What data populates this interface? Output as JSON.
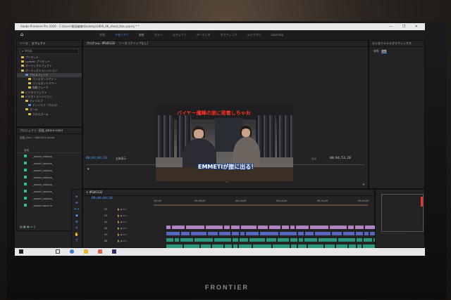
{
  "titlebar": {
    "title": "Adobe Premiere Pro 2020 - C:\\Users\\動画編集\\Desktop\\1809_06_shoot_bizu.prproj * *"
  },
  "workspaces": {
    "tabs": [
      "学習",
      "アセンブリ",
      "編集",
      "カラー",
      "エフェクト",
      "オーディオ",
      "グラフィック",
      "ライブラリ",
      "Learning"
    ],
    "active": "アセンブリ"
  },
  "left_panel": {
    "tabs": [
      "ソース",
      "エフェクト"
    ],
    "search": "クロス",
    "tree": [
      "プリセット",
      "Lumetri プリセット",
      "オーディオエフェクト",
      "オーディオトランジション",
      "クロスフェード",
      "コンスタントゲイン",
      "コンスタントパワー",
      "指数フェード",
      "ビデオエフェクト",
      "ビデオトランジション",
      "ディゾルブ",
      "ディゾルブ（クロス）",
      "ズーム",
      "クロスズーム"
    ]
  },
  "project_panel": {
    "title": "プロジェクト: 容疑_kotare.ssekt",
    "file": "容疑_kota....0B01022.prproj",
    "column": "名前",
    "items": [
      "_sound_various_",
      "_sound_various_",
      "_sound_various_",
      "_sound_various_",
      "_sound_various_",
      "_sound_various_",
      "_sound_various_",
      "_sound voice m"
    ]
  },
  "program_monitor": {
    "tab": "プログラム: IPS45132",
    "tab2": "ソース: (クリップなし)",
    "timecode": "00;04;04;26",
    "fit": "全体表示",
    "scale": "1/2",
    "duration": "00;04;51;28",
    "subtitle_top": "バイヤー魔峰の旅に密着しちゃお",
    "subtitle_bottom": "EMMETIが旅に出る！"
  },
  "timeline": {
    "tab": "IPS45132",
    "timecode": "00;04;04;26",
    "ruler": [
      ":00;00",
      "00;08;00",
      "00;16;00",
      "00;24;00",
      "00;32;00",
      "00;40;00"
    ],
    "tracks": [
      "V2",
      "V1",
      "A1",
      "A2",
      "A3",
      "A4"
    ]
  },
  "essential_graphics": {
    "title": "エッセンシャルグラフィックス",
    "tabs": [
      "参照",
      "編集"
    ]
  },
  "brand": "FRONTIER"
}
